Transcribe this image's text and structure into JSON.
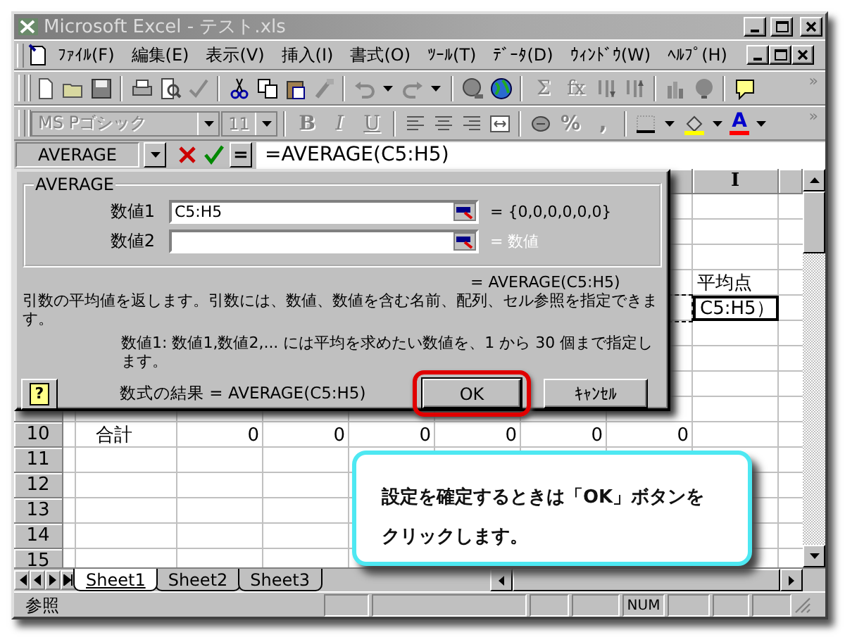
{
  "window": {
    "title": "Microsoft Excel - テスト.xls"
  },
  "menu": [
    {
      "label": "ﾌｧｲﾙ(F)"
    },
    {
      "label": "編集(E)"
    },
    {
      "label": "表示(V)"
    },
    {
      "label": "挿入(I)"
    },
    {
      "label": "書式(O)"
    },
    {
      "label": "ﾂｰﾙ(T)"
    },
    {
      "label": "ﾃﾞｰﾀ(D)"
    },
    {
      "label": "ｳｨﾝﾄﾞｳ(W)"
    },
    {
      "label": "ﾍﾙﾌﾟ(H)"
    }
  ],
  "standard_toolbar": {
    "text_buttons": [
      {
        "label": "Σ",
        "disabled": true
      },
      {
        "label": "fx",
        "disabled": true
      }
    ],
    "overflow": "»"
  },
  "formatting_toolbar": {
    "font": {
      "value": "MS Pゴシック",
      "disabled": true
    },
    "size": {
      "value": "11",
      "disabled": true
    },
    "style_buttons": [
      {
        "label": "B",
        "disabled": true
      },
      {
        "label": "I",
        "disabled": true
      },
      {
        "label": "U",
        "disabled": true
      }
    ],
    "number_buttons": [
      {
        "label": "%",
        "disabled": true
      },
      {
        "label": ",",
        "disabled": true
      }
    ],
    "font_color_button": {
      "label": "A"
    },
    "overflow": "»"
  },
  "formula_bar": {
    "name_box": "AVERAGE",
    "equals_button": "=",
    "formula": "=AVERAGE(C5:H5)"
  },
  "dialog": {
    "group_title": "AVERAGE",
    "arguments": [
      {
        "label": "数値1",
        "value": "C5:H5",
        "result": "= {0,0,0,0,0,0}",
        "result_disabled": false
      },
      {
        "label": "数値2",
        "result": "= 数値",
        "result_disabled": true
      }
    ],
    "function_result": "= AVERAGE(C5:H5)",
    "description": "引数の平均値を返します。引数には、数値、数値を含む名前、配列、セル参照を指定できます。",
    "argument_help": "数値1: 数値1,数値2,... には平均を求めたい数値を、1 から 30 個まで指定します。",
    "help_button": "?",
    "formula_result": "数式の結果 = AVERAGE(C5:H5)",
    "buttons": [
      {
        "label": "OK",
        "highlighted": true
      },
      {
        "label": "ｷｬﾝｾﾙ",
        "highlighted": false
      }
    ]
  },
  "sheet": {
    "column_headings": [
      {
        "label": "I"
      }
    ],
    "rows": [
      {
        "number": "10",
        "label": "合計",
        "values": [
          "0",
          "0",
          "0",
          "0",
          "0",
          "0"
        ]
      },
      {
        "number": "11"
      },
      {
        "number": "12"
      },
      {
        "number": "13"
      },
      {
        "number": "14"
      },
      {
        "number": "15"
      }
    ],
    "column_i_cells": [
      {
        "text": "平均点",
        "kind": "plain"
      },
      {
        "text": "C5:H5）",
        "kind": "editing"
      }
    ]
  },
  "sheet_tabs": [
    {
      "label": "Sheet1",
      "selected": true
    },
    {
      "label": "Sheet2",
      "selected": false
    },
    {
      "label": "Sheet3",
      "selected": false
    }
  ],
  "status_bar": {
    "mode": "参照",
    "indicators": [
      {
        "label": "NUM"
      }
    ]
  },
  "callout": {
    "text": "設定を確定するときは「OK」ボタンをクリックします。"
  }
}
